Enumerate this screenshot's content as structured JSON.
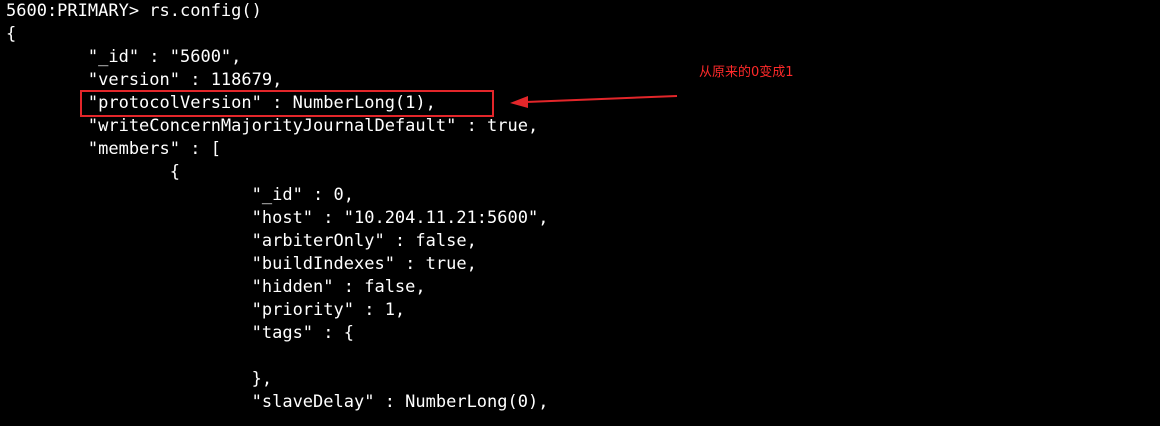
{
  "terminal": {
    "lines": [
      "5600:PRIMARY> rs.config()",
      "{",
      "        \"_id\" : \"5600\",",
      "        \"version\" : 118679,",
      "        \"protocolVersion\" : NumberLong(1),",
      "        \"writeConcernMajorityJournalDefault\" : true,",
      "        \"members\" : [",
      "                {",
      "                        \"_id\" : 0,",
      "                        \"host\" : \"10.204.11.21:5600\",",
      "                        \"arbiterOnly\" : false,",
      "                        \"buildIndexes\" : true,",
      "                        \"hidden\" : false,",
      "                        \"priority\" : 1,",
      "                        \"tags\" : {",
      "",
      "                        },",
      "                        \"slaveDelay\" : NumberLong(0),"
    ]
  },
  "annotation": {
    "text": "从原来的0变成1",
    "color": "#e3262a"
  }
}
